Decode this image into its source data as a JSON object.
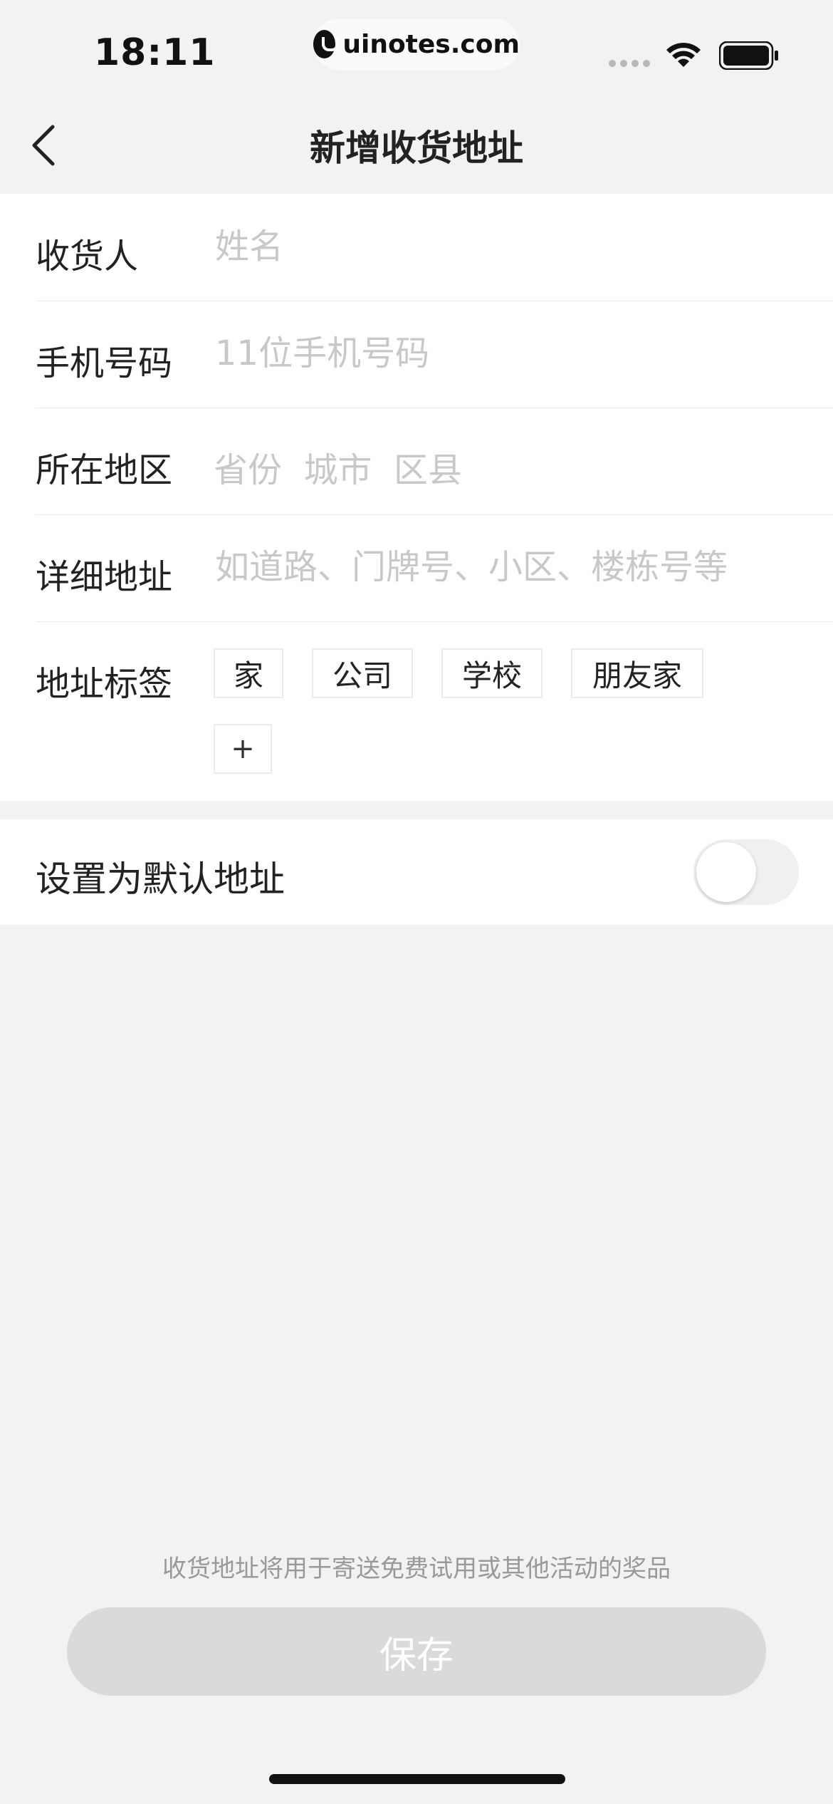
{
  "status": {
    "time": "18:11",
    "url": "uinotes.com"
  },
  "nav": {
    "title": "新增收货地址"
  },
  "form": {
    "recipient": {
      "label": "收货人",
      "placeholder": "姓名"
    },
    "phone": {
      "label": "手机号码",
      "placeholder": "11位手机号码"
    },
    "region": {
      "label": "所在地区",
      "placeholder": "省份  城市  区县"
    },
    "detail": {
      "label": "详细地址",
      "placeholder": "如道路、门牌号、小区、楼栋号等"
    },
    "tags": {
      "label": "地址标签",
      "items": [
        "家",
        "公司",
        "学校",
        "朋友家"
      ],
      "add": "+"
    }
  },
  "default_address": {
    "label": "设置为默认地址",
    "enabled": false
  },
  "footer": {
    "hint": "收货地址将用于寄送免费试用或其他活动的奖品",
    "save_label": "保存"
  },
  "colors": {
    "background": "#f2f2f3",
    "card": "#ffffff",
    "placeholder": "#c8c8c8",
    "button_disabled": "#dadada"
  }
}
